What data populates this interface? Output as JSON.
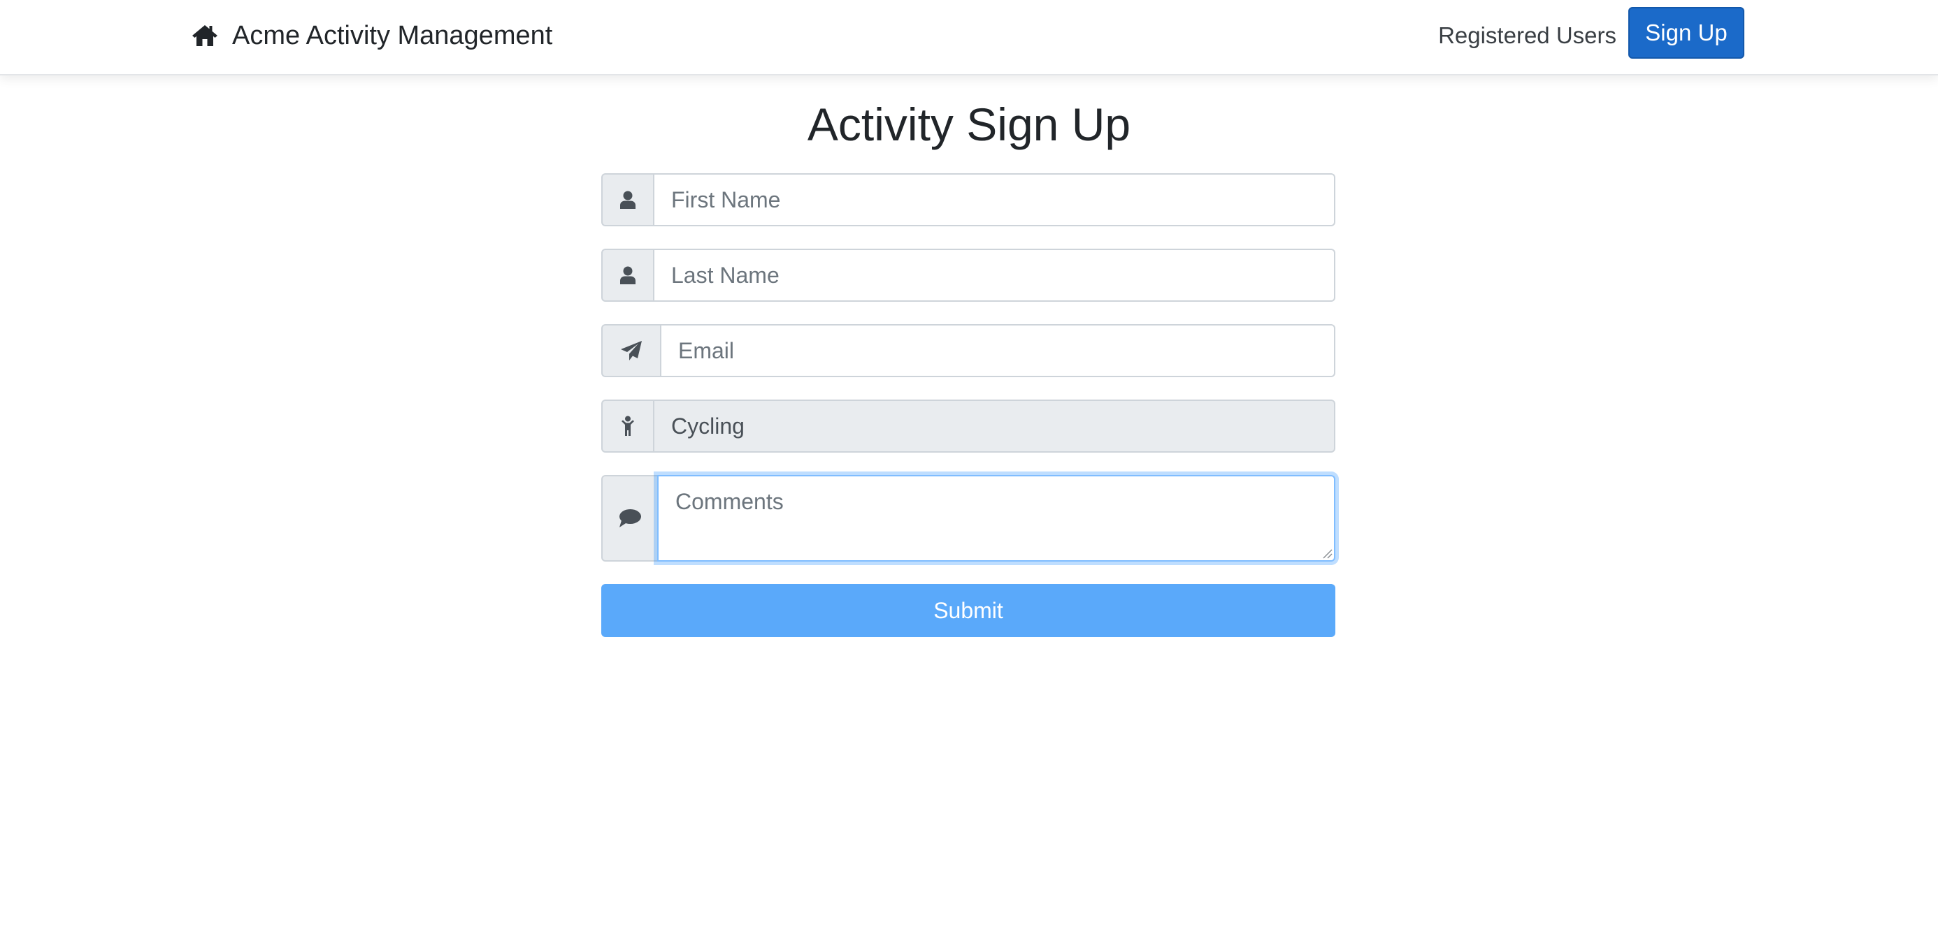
{
  "navbar": {
    "brand_icon": "home-icon",
    "brand_text": "Acme Activity Management",
    "registered_users_label": "Registered Users",
    "signup_label": "Sign Up",
    "signup_color": "#1b6ac9"
  },
  "main": {
    "title": "Activity Sign Up",
    "form": {
      "first_name": {
        "icon": "user-icon",
        "placeholder": "First Name",
        "value": ""
      },
      "last_name": {
        "icon": "user-icon",
        "placeholder": "Last Name",
        "value": ""
      },
      "email": {
        "icon": "paper-plane-icon",
        "placeholder": "Email",
        "value": ""
      },
      "activity": {
        "icon": "child-icon",
        "value": "Cycling",
        "readonly": true
      },
      "comments": {
        "icon": "comment-icon",
        "placeholder": "Comments",
        "value": "",
        "focused": true
      },
      "submit_label": "Submit",
      "submit_color": "#5aa9fa"
    }
  }
}
